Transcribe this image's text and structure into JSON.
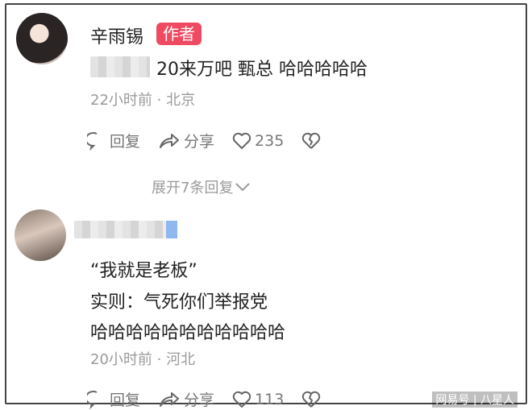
{
  "comment1": {
    "username": "辛雨锡",
    "badge": "作者",
    "text": "20来万吧  甄总  哈哈哈哈哈",
    "time_location": "22小时前 · 北京",
    "reply_label": "回复",
    "share_label": "分享",
    "like_count": "235",
    "expand_label": "展开7条回复"
  },
  "comment2": {
    "line1": "“我就是老板”",
    "line2": "实则：气死你们举报党",
    "line3": "哈哈哈哈哈哈哈哈哈哈哈",
    "time_location": "20小时前 · 河北",
    "reply_label": "回复",
    "share_label": "分享",
    "like_count": "113"
  },
  "watermark": "网易号 | 八星人",
  "colors": {
    "badge": "#ef4a61",
    "meta": "#9a9a9a"
  }
}
